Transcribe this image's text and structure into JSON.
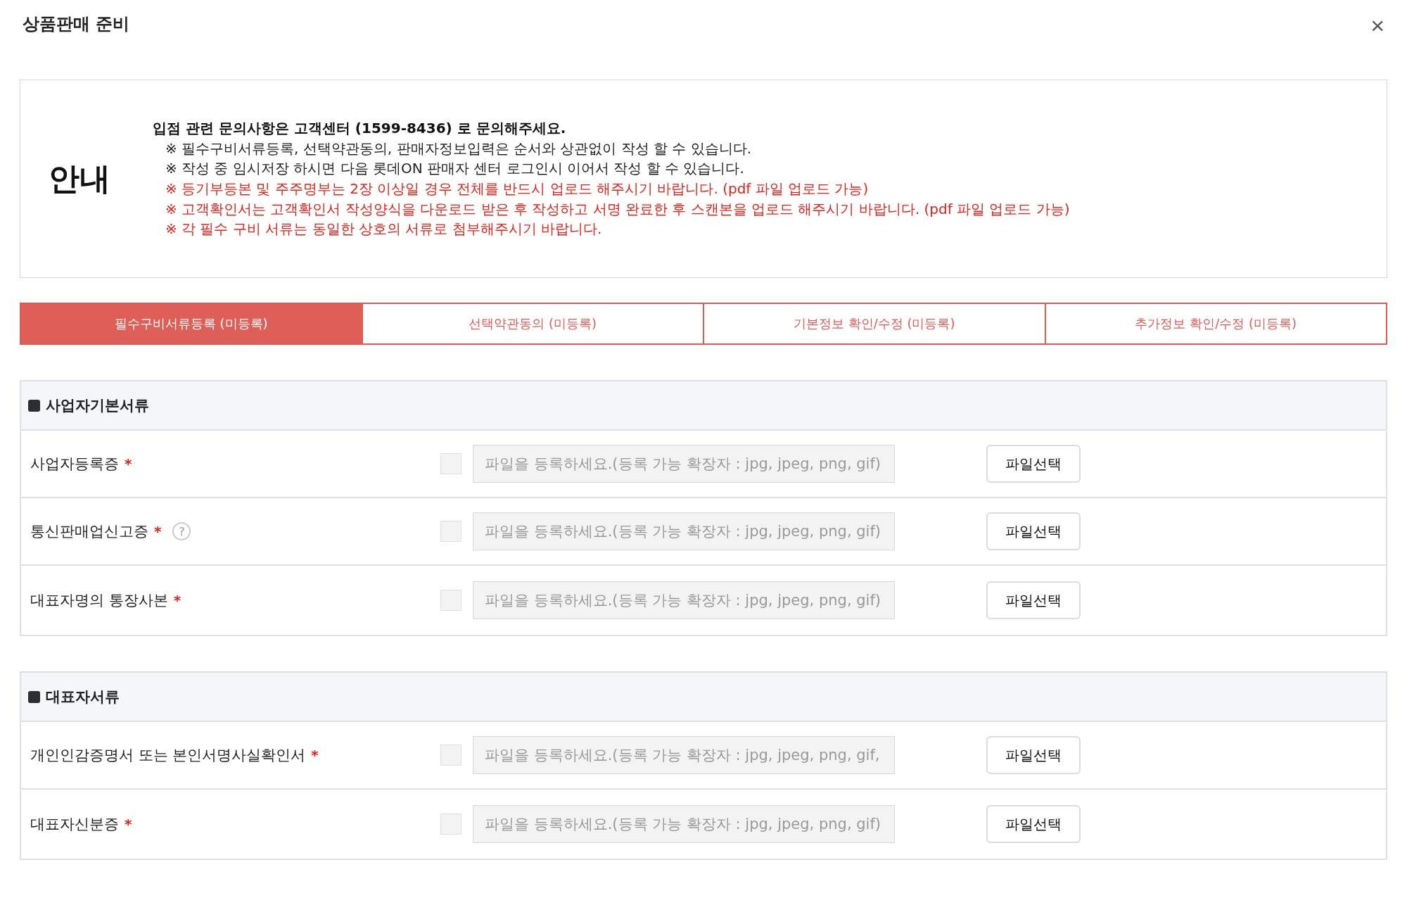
{
  "dialog": {
    "title": "상품판매 준비",
    "close": "×"
  },
  "notice": {
    "heading": "안내",
    "lines": [
      {
        "kind": "heading",
        "text": "입점 관련 문의사항은 고객센터 (1599-8436) 로 문의해주세요."
      },
      {
        "kind": "note",
        "text": "※ 필수구비서류등록, 선택약관동의, 판매자정보입력은 순서와 상관없이 작성 할 수 있습니다."
      },
      {
        "kind": "note",
        "text": "※ 작성 중 임시저장 하시면 다음 롯데ON 판매자 센터 로그인시 이어서 작성 할 수 있습니다."
      },
      {
        "kind": "warning",
        "text": "※ 등기부등본 및 주주명부는 2장 이상일 경우 전체를 반드시 업로드 해주시기 바랍니다. (pdf 파일 업로드 가능)"
      },
      {
        "kind": "warning",
        "text": "※ 고객확인서는 고객확인서 작성양식을 다운로드 받은 후 작성하고 서명 완료한 후 스캔본을 업로드 해주시기 바랍니다. (pdf 파일 업로드 가능)"
      },
      {
        "kind": "warning",
        "text": "※ 각 필수 구비 서류는 동일한 상호의 서류로 첨부해주시기 바랍니다."
      }
    ]
  },
  "tabs": [
    {
      "label": "필수구비서류등록 (미등록)",
      "selected": true
    },
    {
      "label": "선택약관동의 (미등록)",
      "selected": false
    },
    {
      "label": "기본정보 확인/수정 (미등록)",
      "selected": false
    },
    {
      "label": "추가정보 확인/수정 (미등록)",
      "selected": false
    }
  ],
  "sections": [
    {
      "title": "사업자기본서류",
      "rows": [
        {
          "label": "사업자등록증",
          "required": "*",
          "checked": false,
          "placeholder": "파일을 등록하세요.(등록 가능 확장자 : jpg, jpeg, png, gif)",
          "button": "파일선택"
        },
        {
          "label": "통신판매업신고증",
          "required": "*",
          "help_mark": "?",
          "checked": false,
          "placeholder": "파일을 등록하세요.(등록 가능 확장자 : jpg, jpeg, png, gif)",
          "button": "파일선택"
        },
        {
          "label": "대표자명의 통장사본",
          "required": "*",
          "checked": false,
          "placeholder": "파일을 등록하세요.(등록 가능 확장자 : jpg, jpeg, png, gif)",
          "button": "파일선택"
        }
      ]
    },
    {
      "title": "대표자서류",
      "rows": [
        {
          "label": "개인인감증명서 또는 본인서명사실확인서",
          "required": "*",
          "checked": false,
          "placeholder": "파일을 등록하세요.(등록 가능 확장자 : jpg, jpeg, png, gif,",
          "button": "파일선택"
        },
        {
          "label": "대표자신분증",
          "required": "*",
          "checked": false,
          "placeholder": "파일을 등록하세요.(등록 가능 확장자 : jpg, jpeg, png, gif)",
          "button": "파일선택"
        }
      ]
    }
  ]
}
